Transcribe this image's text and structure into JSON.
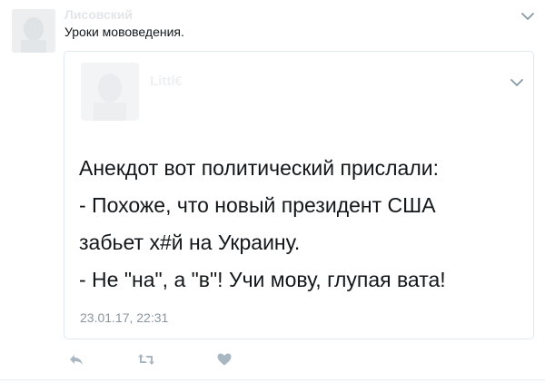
{
  "tweet": {
    "author_name": "Лисовский",
    "text": "Уроки мововедения."
  },
  "quoted_tweet": {
    "author_name": "Littl€",
    "lines": [
      "Анекдот вот политический прислали:",
      "- Похоже, что новый президент США",
      "забьет х#й на Украину.",
      "- Не \"на\", а \"в\"! Учи мову, глупая вата!"
    ],
    "timestamp": "23.01.17, 22:31"
  },
  "actions": {
    "reply_icon": "reply-icon",
    "retweet_icon": "retweet-icon",
    "like_icon": "heart-icon"
  },
  "colors": {
    "icon_gray": "#a9b7c2",
    "chevron_gray": "#8899a6",
    "border": "#e1e8ed",
    "timestamp": "#8a96a0"
  }
}
